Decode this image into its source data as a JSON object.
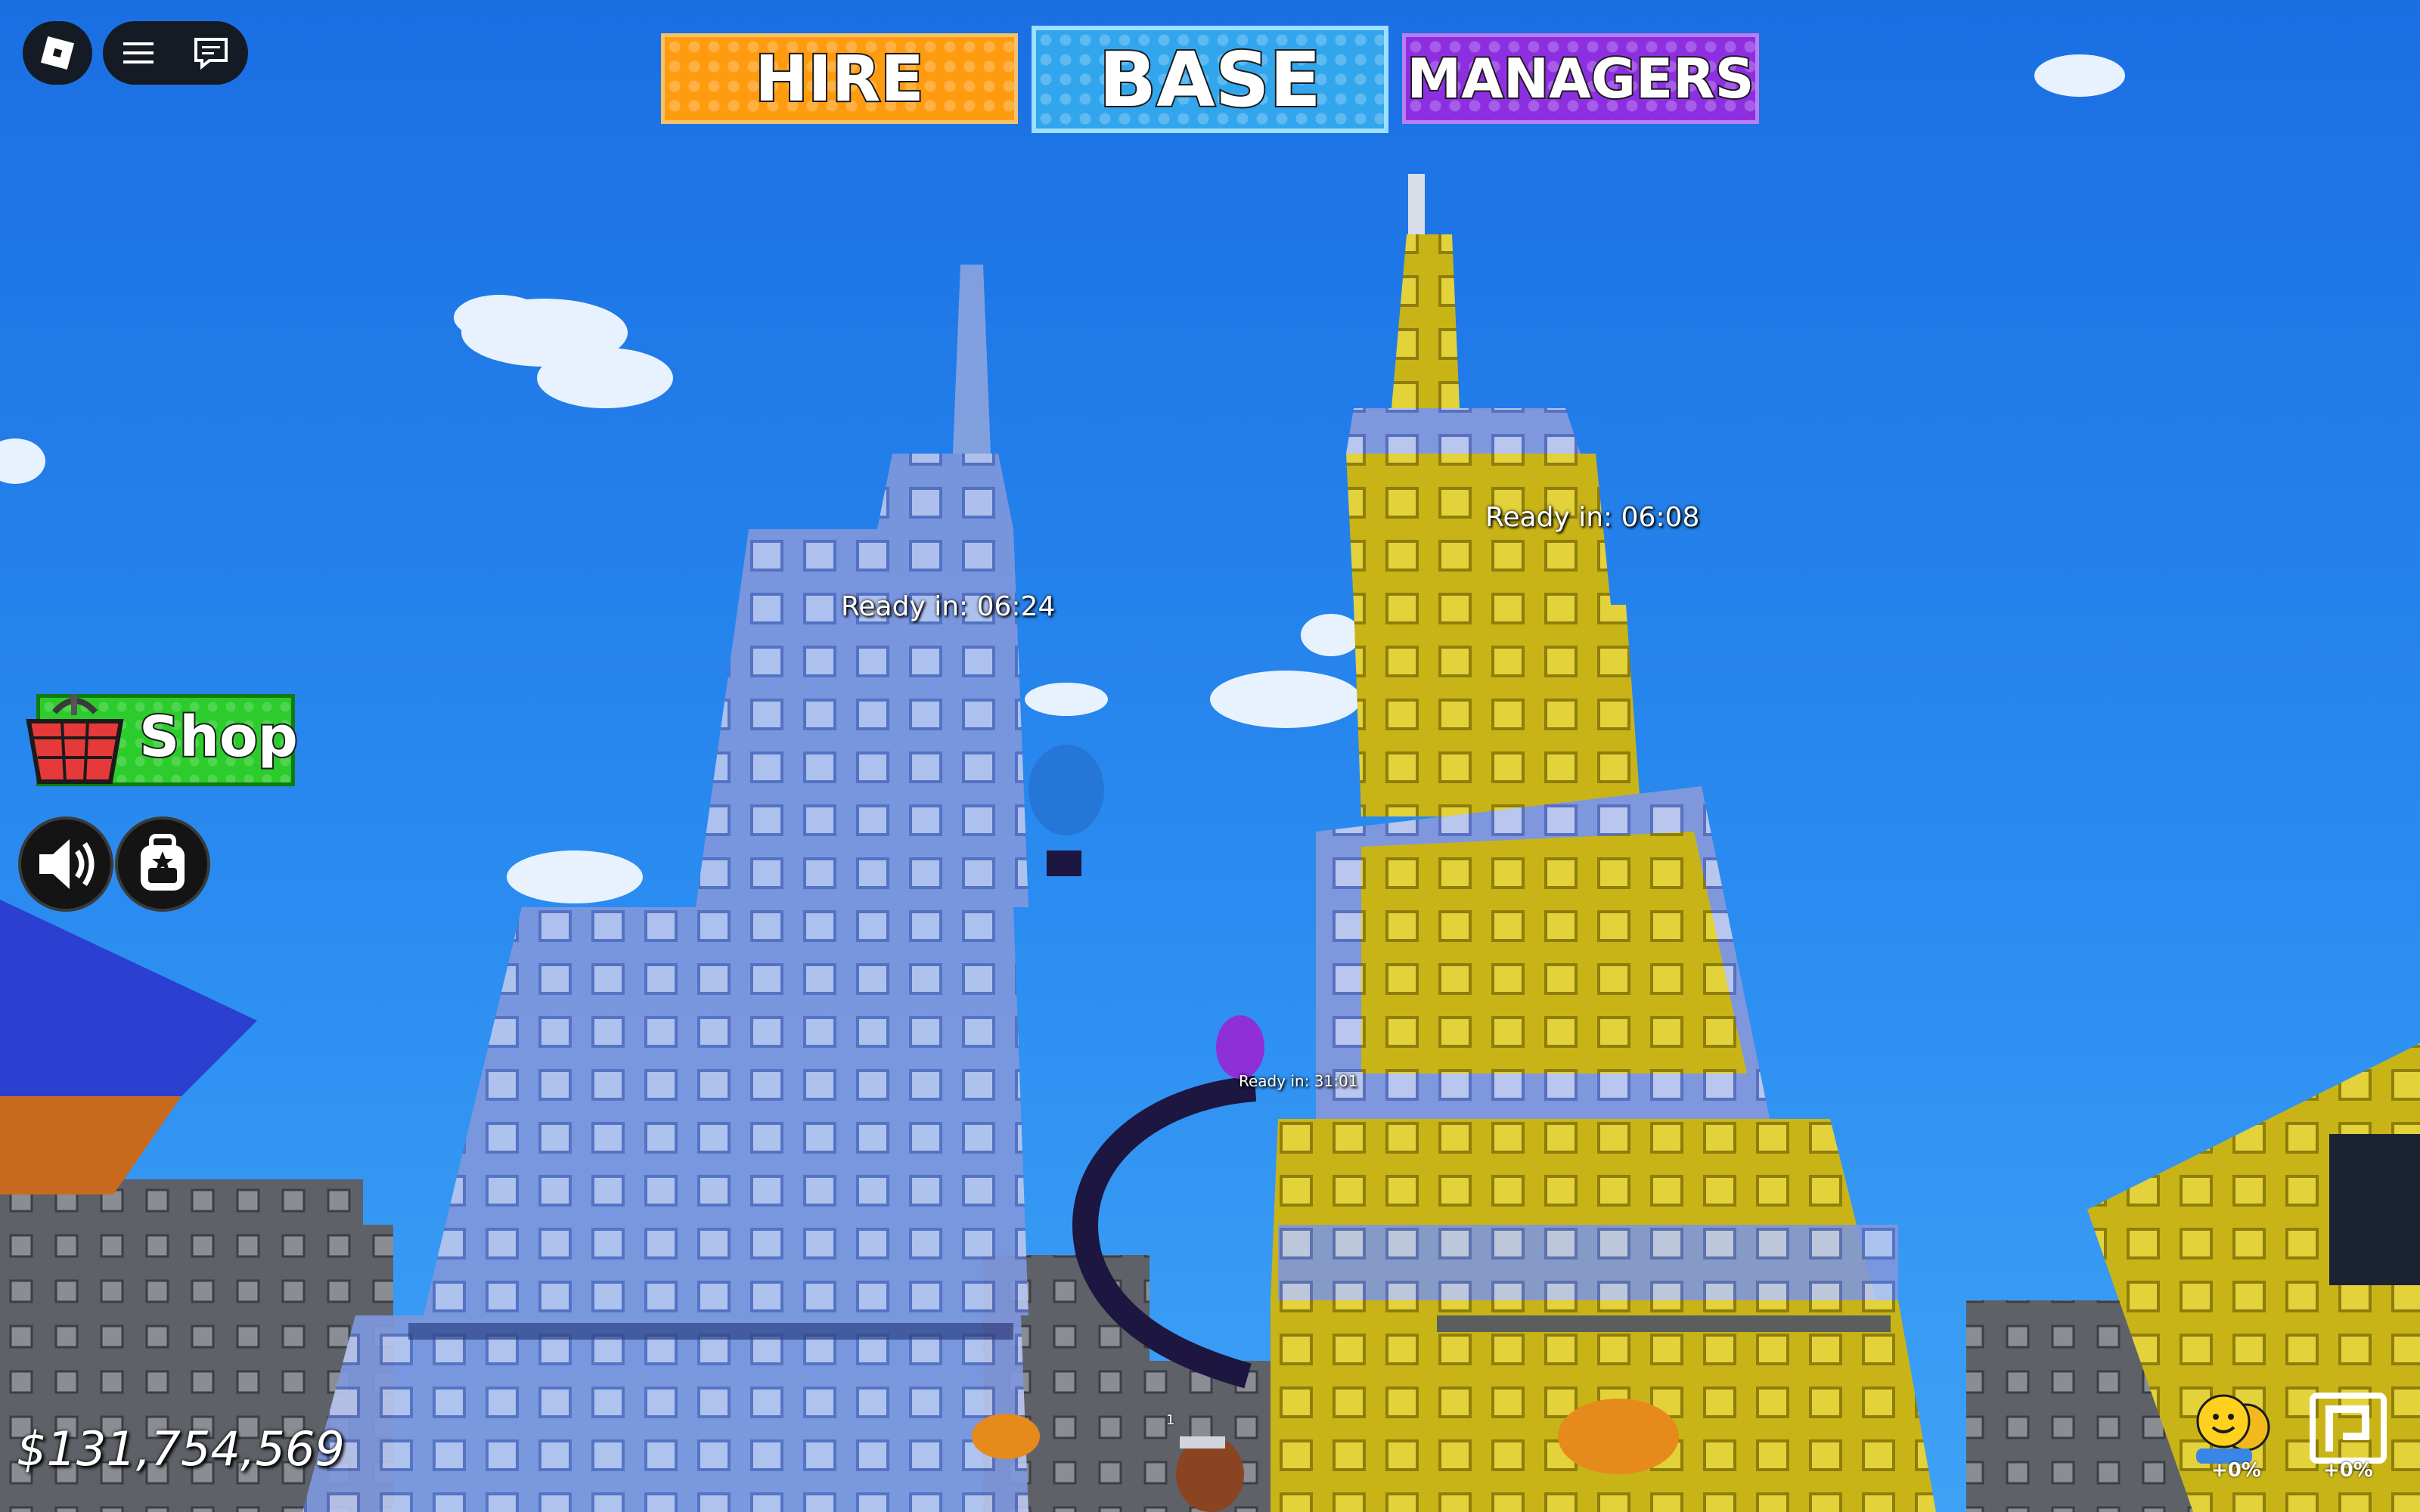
{
  "top_nav": {
    "hire_label": "HIRE",
    "base_label": "BASE",
    "managers_label": "MANAGERS",
    "selected": "BASE"
  },
  "colors": {
    "hire": "#ff9b0f",
    "base": "#31a6ec",
    "managers": "#8d2fe0",
    "shop": "#2bcc2b",
    "sky": "#1f7ae6"
  },
  "roblox_menu": {
    "logo_icon": "roblox-logo-icon",
    "menu_icon": "hamburger-menu-icon",
    "chat_icon": "chat-icon"
  },
  "side_menu": {
    "shop_label": "Shop",
    "shop_icon": "basket-icon",
    "sound_icon": "speaker-icon",
    "inventory_icon": "backpack-icon"
  },
  "world_labels": {
    "left_tower_timer": "Ready in: 06:24",
    "right_tower_timer": "Ready in: 06:08",
    "small_tower_timer": "Ready in: 31:01"
  },
  "hud": {
    "money": "$131,754,569",
    "players_boost": "+0%",
    "rebirth_boost": "+0%",
    "hotbar_slot": "1"
  }
}
